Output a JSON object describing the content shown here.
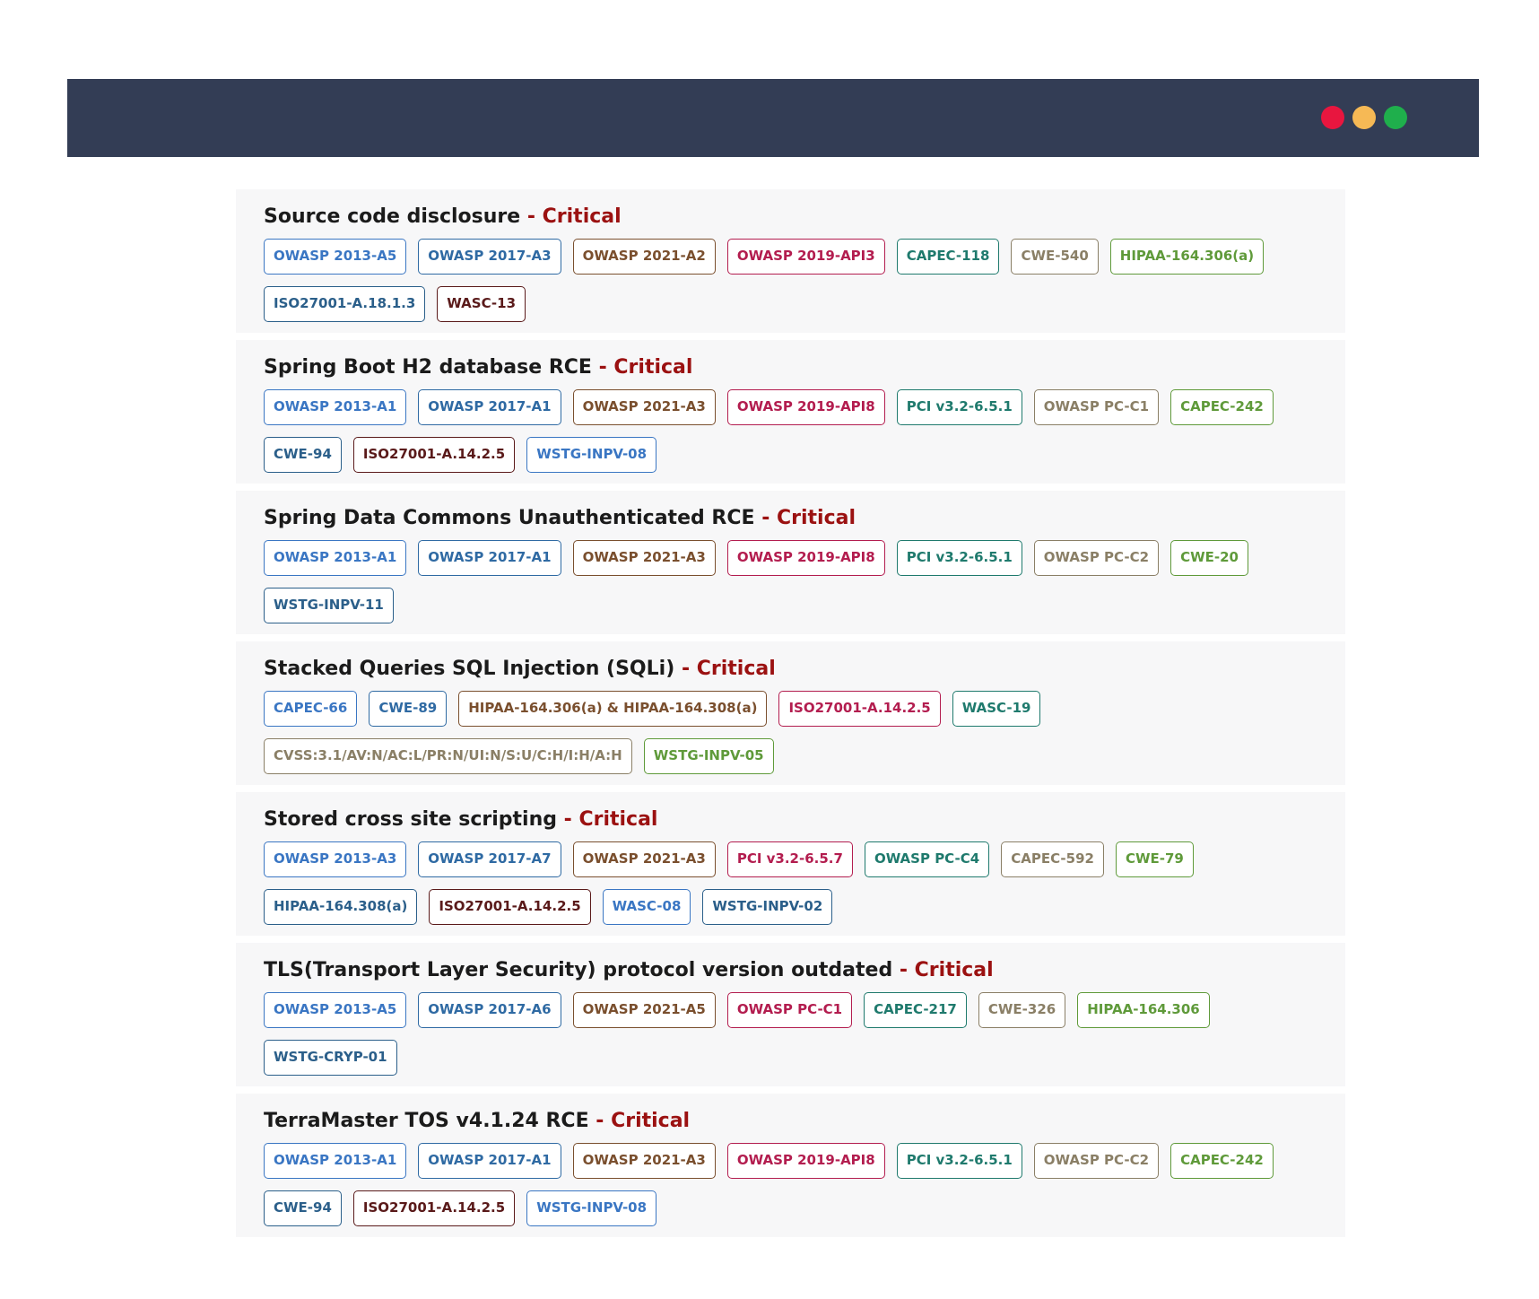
{
  "window": {
    "dot_colors": [
      "#e8163f",
      "#f6b955",
      "#1faf4c"
    ]
  },
  "severity_color": "#9b1111",
  "findings": [
    {
      "title": "Source code disclosure",
      "severity": "- Critical",
      "tags": [
        {
          "label": "OWASP 2013-A5",
          "color": "#3a76c3"
        },
        {
          "label": "OWASP 2017-A3",
          "color": "#2f6aa3"
        },
        {
          "label": "OWASP 2021-A2",
          "color": "#7a4f2e"
        },
        {
          "label": "OWASP 2019-API3",
          "color": "#b31d4f"
        },
        {
          "label": "CAPEC-118",
          "color": "#1f7a6d"
        },
        {
          "label": "CWE-540",
          "color": "#8a7f66"
        },
        {
          "label": "HIPAA-164.306(a)",
          "color": "#5f9a3a"
        },
        {
          "label": "ISO27001-A.18.1.3",
          "color": "#2b5f8a"
        },
        {
          "label": "WASC-13",
          "color": "#5a1a1a"
        }
      ]
    },
    {
      "title": "Spring Boot H2 database RCE",
      "severity": "- Critical",
      "tags": [
        {
          "label": "OWASP 2013-A1",
          "color": "#3a76c3"
        },
        {
          "label": "OWASP 2017-A1",
          "color": "#2f6aa3"
        },
        {
          "label": "OWASP 2021-A3",
          "color": "#7a4f2e"
        },
        {
          "label": "OWASP 2019-API8",
          "color": "#b31d4f"
        },
        {
          "label": "PCI v3.2-6.5.1",
          "color": "#1f7a6d"
        },
        {
          "label": "OWASP PC-C1",
          "color": "#8a7f66"
        },
        {
          "label": "CAPEC-242",
          "color": "#5f9a3a"
        },
        {
          "label": "CWE-94",
          "color": "#2b5f8a"
        },
        {
          "label": "ISO27001-A.14.2.5",
          "color": "#5a1a1a"
        },
        {
          "label": "WSTG-INPV-08",
          "color": "#3a76c3"
        }
      ]
    },
    {
      "title": "Spring Data Commons Unauthenticated RCE",
      "severity": "- Critical",
      "tags": [
        {
          "label": "OWASP 2013-A1",
          "color": "#3a76c3"
        },
        {
          "label": "OWASP 2017-A1",
          "color": "#2f6aa3"
        },
        {
          "label": "OWASP 2021-A3",
          "color": "#7a4f2e"
        },
        {
          "label": "OWASP 2019-API8",
          "color": "#b31d4f"
        },
        {
          "label": "PCI v3.2-6.5.1",
          "color": "#1f7a6d"
        },
        {
          "label": "OWASP PC-C2",
          "color": "#8a7f66"
        },
        {
          "label": "CWE-20",
          "color": "#5f9a3a"
        },
        {
          "label": "WSTG-INPV-11",
          "color": "#2b5f8a"
        }
      ]
    },
    {
      "title": "Stacked Queries SQL Injection (SQLi)",
      "severity": "- Critical",
      "tags": [
        {
          "label": "CAPEC-66",
          "color": "#3a76c3"
        },
        {
          "label": "CWE-89",
          "color": "#2f6aa3"
        },
        {
          "label": "HIPAA-164.306(a) & HIPAA-164.308(a)",
          "color": "#7a4f2e"
        },
        {
          "label": "ISO27001-A.14.2.5",
          "color": "#b31d4f"
        },
        {
          "label": "WASC-19",
          "color": "#1f7a6d"
        },
        {
          "label": "CVSS:3.1/AV:N/AC:L/PR:N/UI:N/S:U/C:H/I:H/A:H",
          "color": "#8a7f66"
        },
        {
          "label": "WSTG-INPV-05",
          "color": "#5f9a3a"
        }
      ]
    },
    {
      "title": "Stored cross site scripting",
      "severity": "- Critical",
      "tags": [
        {
          "label": "OWASP 2013-A3",
          "color": "#3a76c3"
        },
        {
          "label": "OWASP 2017-A7",
          "color": "#2f6aa3"
        },
        {
          "label": "OWASP 2021-A3",
          "color": "#7a4f2e"
        },
        {
          "label": "PCI v3.2-6.5.7",
          "color": "#b31d4f"
        },
        {
          "label": "OWASP PC-C4",
          "color": "#1f7a6d"
        },
        {
          "label": "CAPEC-592",
          "color": "#8a7f66"
        },
        {
          "label": "CWE-79",
          "color": "#5f9a3a"
        },
        {
          "label": "HIPAA-164.308(a)",
          "color": "#2b5f8a"
        },
        {
          "label": "ISO27001-A.14.2.5",
          "color": "#5a1a1a"
        },
        {
          "label": "WASC-08",
          "color": "#3a76c3"
        },
        {
          "label": "WSTG-INPV-02",
          "color": "#2b5f8a"
        }
      ]
    },
    {
      "title": "TLS(Transport Layer Security) protocol version outdated",
      "severity": "- Critical",
      "tags": [
        {
          "label": "OWASP 2013-A5",
          "color": "#3a76c3"
        },
        {
          "label": "OWASP 2017-A6",
          "color": "#2f6aa3"
        },
        {
          "label": "OWASP 2021-A5",
          "color": "#7a4f2e"
        },
        {
          "label": "OWASP PC-C1",
          "color": "#b31d4f"
        },
        {
          "label": "CAPEC-217",
          "color": "#1f7a6d"
        },
        {
          "label": "CWE-326",
          "color": "#8a7f66"
        },
        {
          "label": "HIPAA-164.306",
          "color": "#5f9a3a"
        },
        {
          "label": "WSTG-CRYP-01",
          "color": "#2b5f8a"
        }
      ]
    },
    {
      "title": "TerraMaster TOS v4.1.24 RCE",
      "severity": "- Critical",
      "tags": [
        {
          "label": "OWASP 2013-A1",
          "color": "#3a76c3"
        },
        {
          "label": "OWASP 2017-A1",
          "color": "#2f6aa3"
        },
        {
          "label": "OWASP 2021-A3",
          "color": "#7a4f2e"
        },
        {
          "label": "OWASP 2019-API8",
          "color": "#b31d4f"
        },
        {
          "label": "PCI v3.2-6.5.1",
          "color": "#1f7a6d"
        },
        {
          "label": "OWASP PC-C2",
          "color": "#8a7f66"
        },
        {
          "label": "CAPEC-242",
          "color": "#5f9a3a"
        },
        {
          "label": "CWE-94",
          "color": "#2b5f8a"
        },
        {
          "label": "ISO27001-A.14.2.5",
          "color": "#5a1a1a"
        },
        {
          "label": "WSTG-INPV-08",
          "color": "#3a76c3"
        }
      ]
    }
  ]
}
